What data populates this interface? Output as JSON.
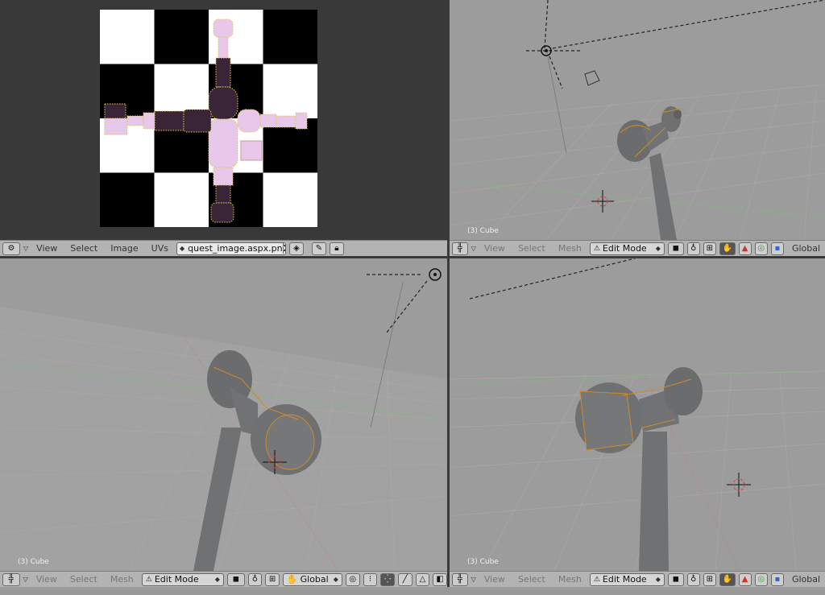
{
  "uv_editor": {
    "header": {
      "menus": [
        "View",
        "Select",
        "Image",
        "UVs"
      ],
      "image_name": "quest_image.aspx.pn",
      "close_glyph": "X",
      "icons": [
        "editor-type-icon",
        "image-browse-icon",
        "pin-icon",
        "lock-icon"
      ]
    }
  },
  "viewport_top_right": {
    "label": "(3) Cube",
    "header": {
      "menus": [
        "View",
        "Select",
        "Mesh"
      ],
      "mode": "Edit Mode",
      "orientation": "Global"
    }
  },
  "viewport_bottom_left": {
    "label": "(3) Cube",
    "header": {
      "menus": [
        "View",
        "Select",
        "Mesh"
      ],
      "mode": "Edit Mode",
      "orientation": "Global"
    }
  },
  "viewport_bottom_right": {
    "label": "(3) Cube",
    "header": {
      "menus": [
        "View",
        "Select",
        "Mesh"
      ],
      "mode": "Edit Mode",
      "orientation": "Global"
    }
  },
  "colors": {
    "viewport_bg": "#9c9c9c",
    "header_bg": "#b3b3b3",
    "uv_bg": "#393939",
    "uv_island_fill": "#e7c8ea",
    "uv_island_dark": "#3a2438",
    "mesh_gray": "#6f7173",
    "edge_select": "#d08a28"
  }
}
